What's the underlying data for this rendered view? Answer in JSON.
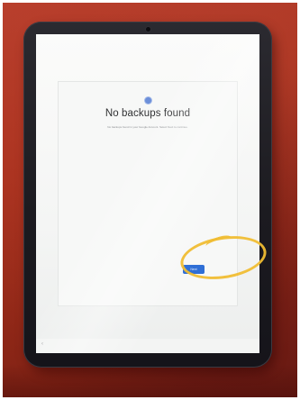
{
  "screen": {
    "title": "No backups found",
    "subtitle": "No backups found in your Google Account. Select Next to continue.",
    "next_label": "Next",
    "nav_back": "‹"
  },
  "icons": {
    "header": "backup-icon",
    "nav": "back-chevron-icon"
  },
  "colors": {
    "button": "#2f6fd6",
    "highlight": "#f0bd33",
    "surface": "#8f2717",
    "screen": "#f7f8f7"
  }
}
